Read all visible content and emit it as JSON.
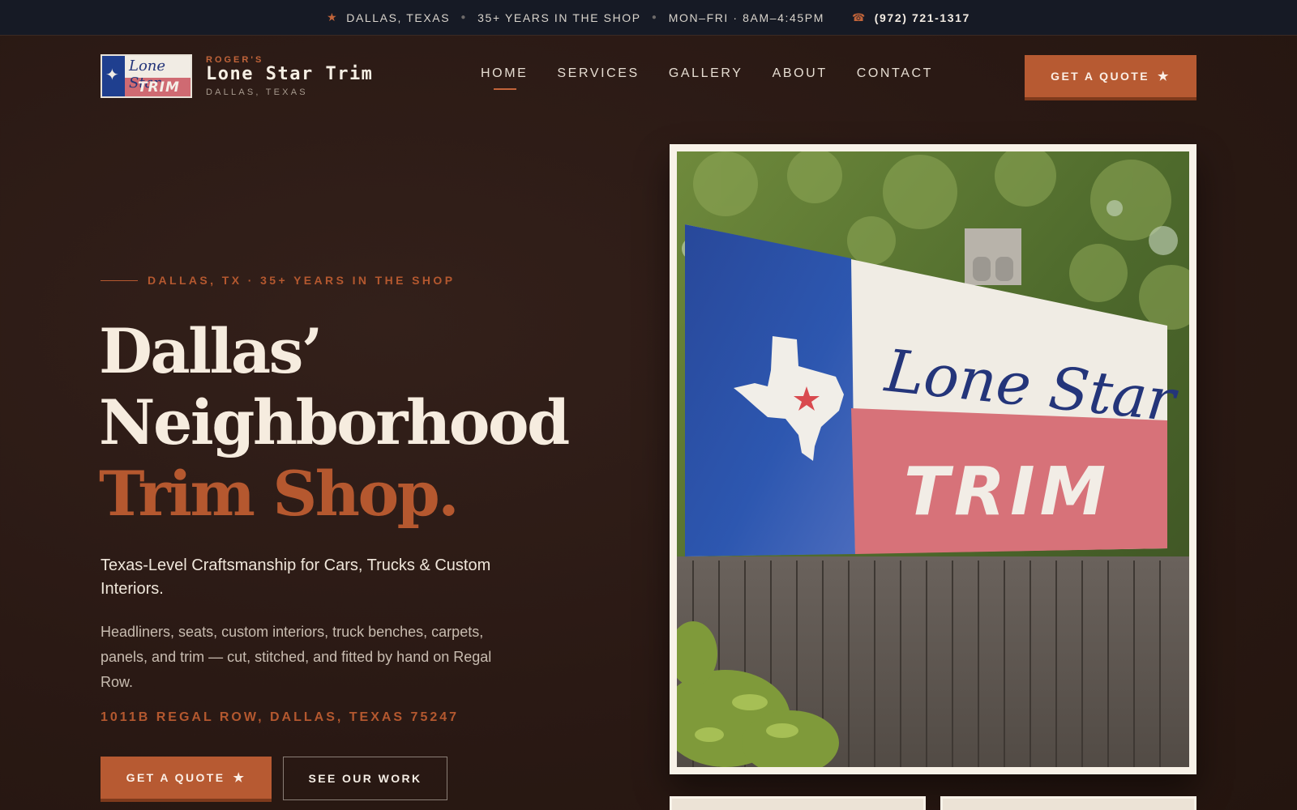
{
  "topbar": {
    "location": "DALLAS, TEXAS",
    "experience": "35+ YEARS IN THE SHOP",
    "hours": "MON–FRI · 8AM–4:45PM",
    "phone": "(972) 721-1317"
  },
  "brand": {
    "kicker": "ROGER'S",
    "name": "Lone Star Trim",
    "city": "DALLAS, TEXAS",
    "logo_script": "Lone Star",
    "logo_trim": "TRIM"
  },
  "nav": {
    "items": [
      {
        "label": "HOME",
        "active": true
      },
      {
        "label": "SERVICES",
        "active": false
      },
      {
        "label": "GALLERY",
        "active": false
      },
      {
        "label": "ABOUT",
        "active": false
      },
      {
        "label": "CONTACT",
        "active": false
      }
    ],
    "cta": "GET A QUOTE"
  },
  "hero": {
    "eyebrow": "DALLAS, TX · 35+ YEARS IN THE SHOP",
    "headline_line1": "Dallas’",
    "headline_line2": "Neighborhood",
    "headline_accent": "Trim Shop.",
    "subhead": "Texas-Level Craftsmanship for Cars, Trucks & Custom Interiors.",
    "body": "Headliners, seats, custom interiors, truck benches, carpets, panels, and trim — cut, stitched, and fitted by hand on Regal Row.",
    "address": "1011B REGAL ROW, DALLAS, TEXAS 75247",
    "cta_primary": "GET A QUOTE",
    "cta_secondary": "SEE OUR WORK"
  },
  "photo": {
    "sign_script": "Lone Star",
    "sign_trim": "TRIM"
  },
  "colors": {
    "accent": "#b75a32",
    "background": "#2a1914",
    "topbar": "#161a25",
    "cream": "#f6ecdf"
  },
  "icons": {
    "topbar_star": "star-icon",
    "topbar_phone": "phone-icon",
    "cta_star": "star-icon"
  }
}
